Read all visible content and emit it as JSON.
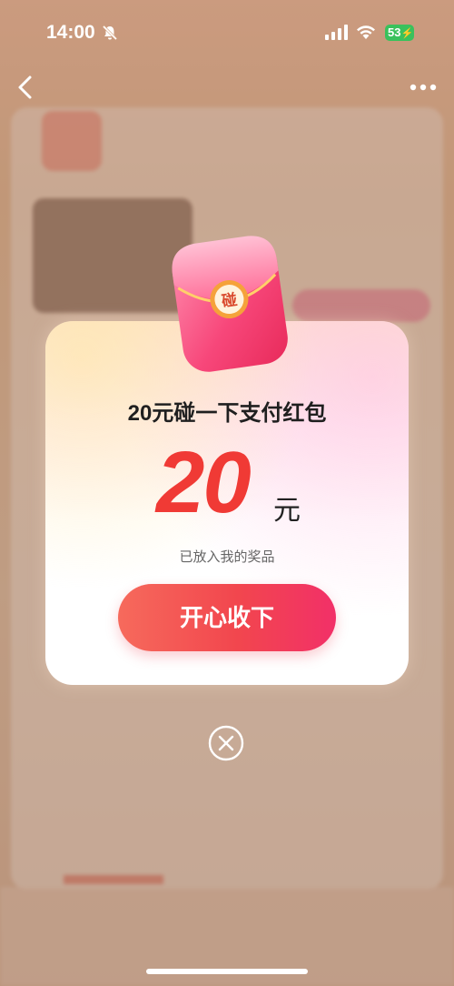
{
  "status_bar": {
    "time": "14:00",
    "battery": "53",
    "icons": [
      "bell-muted-icon",
      "signal-icon",
      "wifi-icon",
      "battery-icon"
    ]
  },
  "nav": {
    "icons": [
      "back-chevron-icon",
      "more-dots-icon"
    ]
  },
  "modal": {
    "title": "20元碰一下支付红包",
    "amount": "20",
    "unit": "元",
    "subtitle": "已放入我的奖品",
    "accept_button": "开心收下",
    "envelope_badge": "碰",
    "close_icon": "close-circle-icon"
  },
  "colors": {
    "amount": "#f03a35",
    "button_start": "#f66a5c",
    "button_end": "#f23068"
  }
}
